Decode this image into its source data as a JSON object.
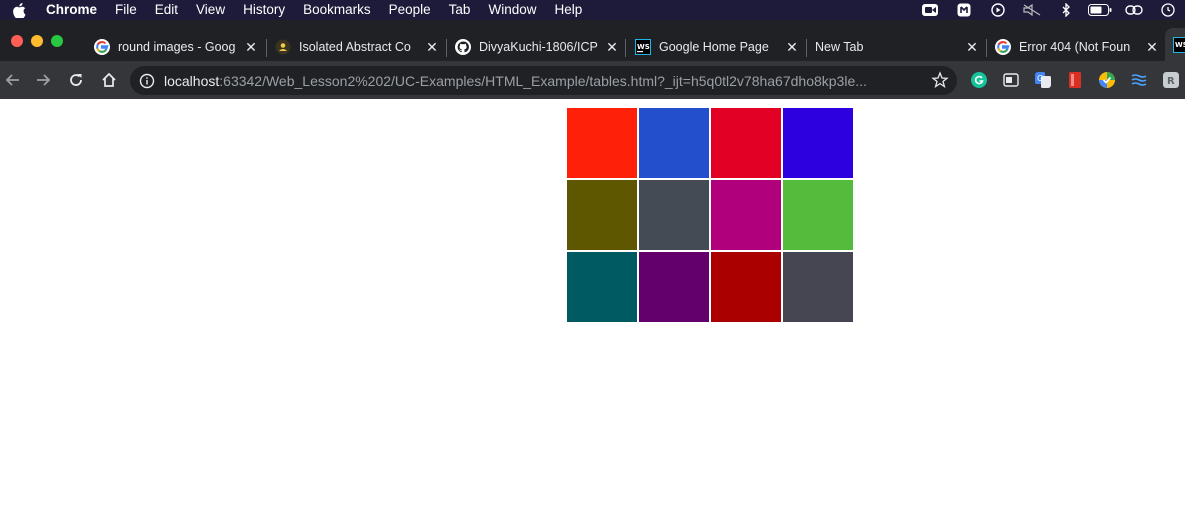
{
  "menubar": {
    "app_name": "Chrome",
    "items": [
      "File",
      "Edit",
      "View",
      "History",
      "Bookmarks",
      "People",
      "Tab",
      "Window",
      "Help"
    ]
  },
  "tabs": [
    {
      "title": "round images - Goog",
      "icon": "google-icon"
    },
    {
      "title": "Isolated Abstract Co",
      "icon": "shutterstock-icon"
    },
    {
      "title": "DivyaKuchi-1806/ICP",
      "icon": "github-icon"
    },
    {
      "title": "Google Home Page",
      "icon": "webstorm-icon"
    },
    {
      "title": "New Tab",
      "icon": ""
    },
    {
      "title": "Error 404 (Not Foun",
      "icon": "google-icon"
    }
  ],
  "address_bar": {
    "host": "localhost",
    "path": ":63342/Web_Lesson2%202/UC-Examples/HTML_Example/tables.html?_ijt=h5q0tl2v78ha67dho8kp3le..."
  },
  "colors": {
    "menubar_bg": "#1d1a3a",
    "tabstrip_bg": "#202124",
    "toolbar_bg": "#35363a"
  },
  "grid": {
    "rows": [
      [
        "#ff200a",
        "#234fcc",
        "#e20024",
        "#2d00e0"
      ],
      [
        "#5e5700",
        "#454b55",
        "#b0007c",
        "#55bb3d"
      ],
      [
        "#005a61",
        "#63006c",
        "#aa0000",
        "#464552"
      ]
    ]
  }
}
